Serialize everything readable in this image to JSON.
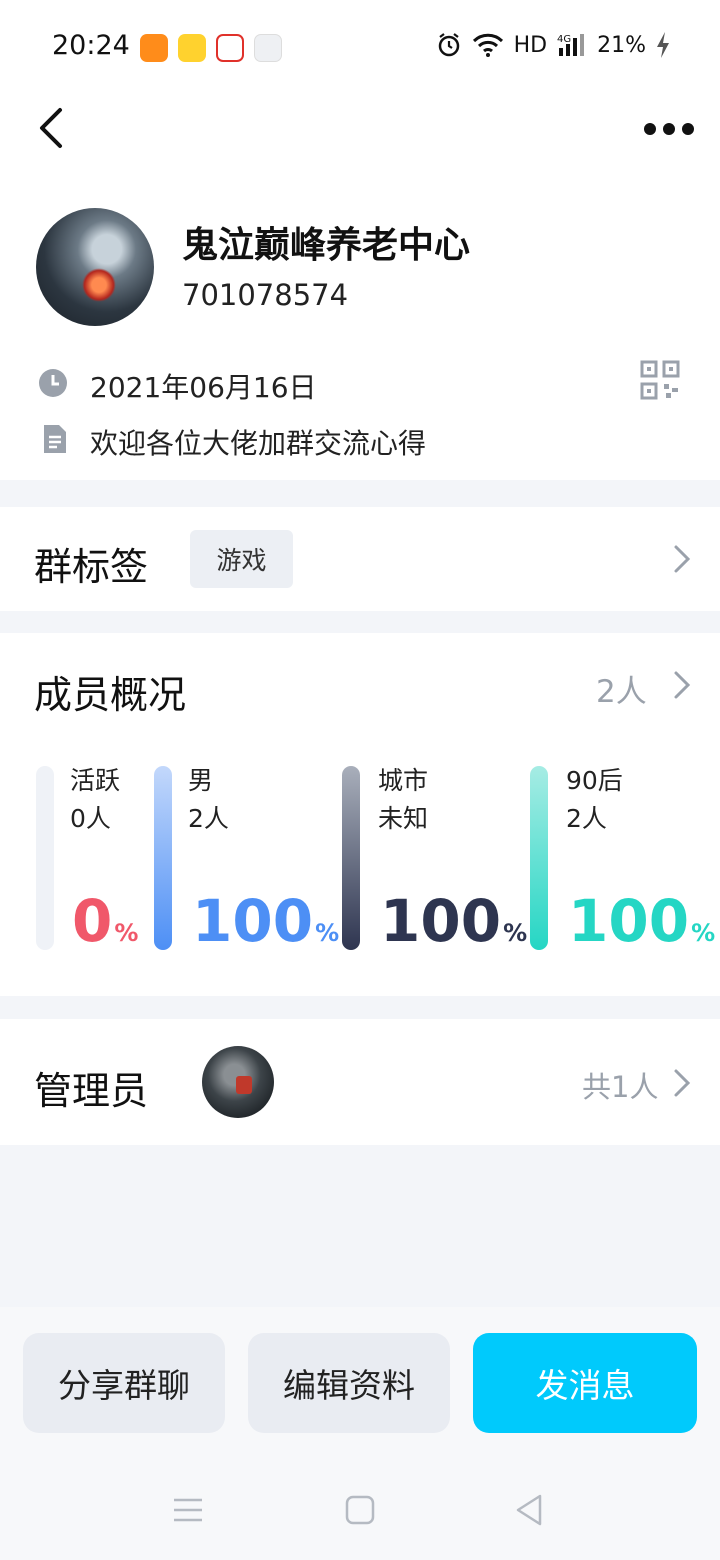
{
  "status_bar": {
    "time": "20:24",
    "network": "HD",
    "battery": "21%",
    "notification_icons": [
      "uc-browser-icon",
      "weibo-icon",
      "app-icon",
      "calendar-icon"
    ]
  },
  "header": {
    "group_name": "鬼泣巅峰养老中心",
    "group_id": "701078574",
    "created_date": "2021年06月16日",
    "description": "欢迎各位大佬加群交流心得"
  },
  "tags_section": {
    "title": "群标签",
    "tag": "游戏"
  },
  "members_section": {
    "title": "成员概况",
    "count": "2人",
    "stats": [
      {
        "label": "活跃",
        "value": "0人",
        "percent": "0",
        "unit": "%",
        "color": "#f0586a"
      },
      {
        "label": "男",
        "value": "2人",
        "percent": "100",
        "unit": "%",
        "color": "#4d8ff5"
      },
      {
        "label": "城市",
        "value": "未知",
        "percent": "100",
        "unit": "%",
        "color": "#2e3550"
      },
      {
        "label": "90后",
        "value": "2人",
        "percent": "100",
        "unit": "%",
        "color": "#25d6c4"
      }
    ]
  },
  "admin_section": {
    "title": "管理员",
    "count": "共1人"
  },
  "actions": {
    "share": "分享群聊",
    "edit": "编辑资料",
    "send": "发消息"
  },
  "colors": {
    "accent": "#00cafc",
    "page_bg": "#f3f5f9",
    "muted_text": "#9aa1ab"
  }
}
